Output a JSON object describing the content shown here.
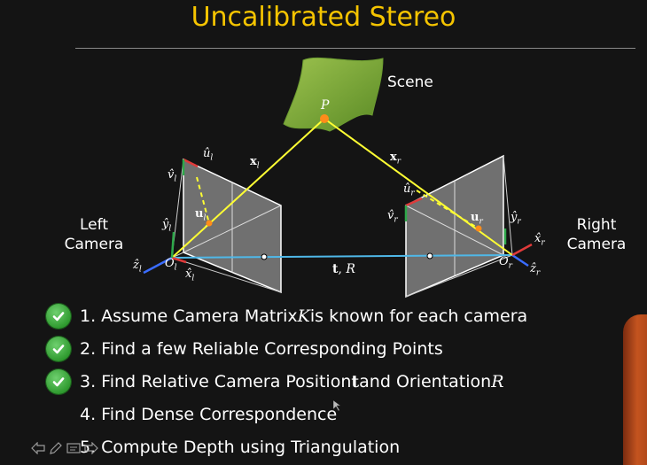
{
  "title": "Uncalibrated Stereo",
  "diagram": {
    "scene_label": "Scene",
    "left_camera_label": [
      "Left",
      "Camera"
    ],
    "right_camera_label": [
      "Right",
      "Camera"
    ],
    "point_label": "P",
    "x_l": "x",
    "x_l_sub": "l",
    "x_r": "x",
    "x_r_sub": "r",
    "u_l": "u",
    "u_l_sub": "l",
    "u_r": "u",
    "u_r_sub": "r",
    "uhat_l": "û",
    "vhat_l": "v̂",
    "yhat_l": "ŷ",
    "zhat_l": "ẑ",
    "xhat_l": "x̂",
    "O_l": "O",
    "sub_l": "l",
    "uhat_r": "û",
    "vhat_r": "v̂",
    "yhat_r": "ŷ",
    "zhat_r": "ẑ",
    "xhat_r": "x̂",
    "O_r": "O",
    "sub_r": "r",
    "baseline_t": "t",
    "baseline_sep": ",",
    "baseline_R": "R"
  },
  "steps": [
    {
      "pre": "1. Assume Camera Matrix ",
      "math": "K",
      "post": " is known for each camera",
      "checked": true
    },
    {
      "pre": "2. Find a few Reliable Corresponding Points",
      "math": "",
      "post": "",
      "checked": true
    },
    {
      "pre": "3. Find Relative Camera Position ",
      "math_bold": "t",
      "mid": " and Orientation ",
      "math": "R",
      "checked": true
    },
    {
      "pre": "4. Find Dense Correspondence",
      "math": "",
      "post": "",
      "checked": false
    },
    {
      "pre": "5. Compute Depth using Triangulation",
      "math": "",
      "post": "",
      "checked": false
    }
  ],
  "colors": {
    "title": "#f5c400",
    "ray": "#ffff33",
    "baseline": "#4fb8e8",
    "point": "#ff8c1a",
    "scene": "#7aa83a",
    "axis_z": "#3a6cff",
    "axis_y": "#2ea84a",
    "axis_x": "#e03a3a"
  },
  "toolbar_icons": [
    "back-arrow-icon",
    "pen-icon",
    "slides-icon",
    "forward-arrow-icon"
  ]
}
